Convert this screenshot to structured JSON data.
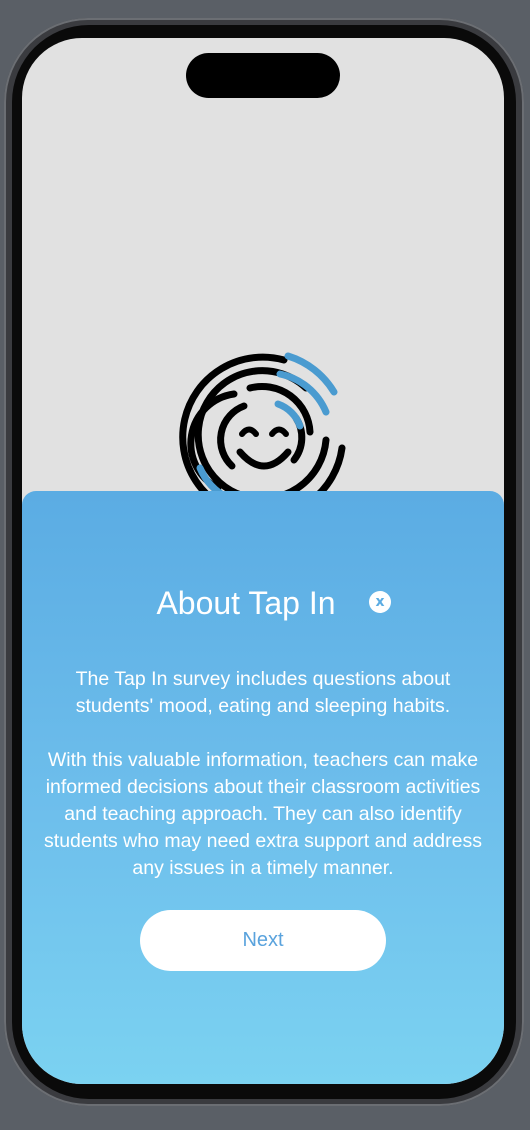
{
  "sheet": {
    "title": "About Tap In",
    "close_icon": "x-circle-icon",
    "close_glyph": "x",
    "paragraph_1_lines": [
      "The Tap In survey includes questions about",
      "students' mood, eating and sleeping habits."
    ],
    "paragraph_2_lines": [
      "With this valuable information, teachers can make",
      "informed decisions about their classroom activities",
      "and teaching approach. They can also identify",
      "students who may need extra support and address",
      "any issues in a timely manner."
    ],
    "next_label": "Next"
  },
  "logo": {
    "icon": "smiley-fingerprint-icon",
    "colors": {
      "dark": "#000000",
      "accent": "#4a9bd0"
    }
  },
  "colors": {
    "sheet_top": "#5bace3",
    "sheet_bottom": "#7bd2f1",
    "screen_background": "#e1e1e1",
    "button_text": "#5aa3dd"
  }
}
